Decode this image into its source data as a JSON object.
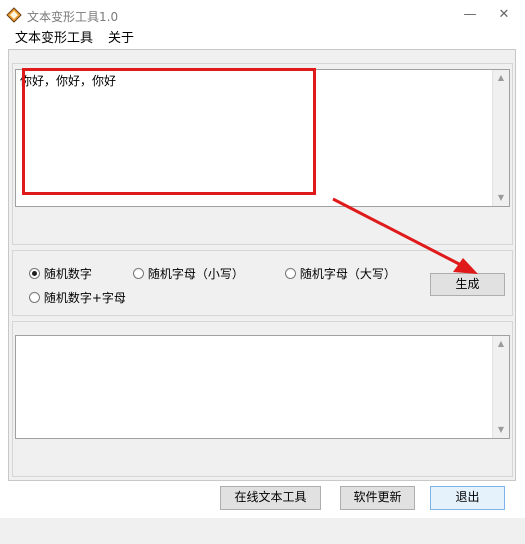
{
  "window": {
    "title": "文本变形工具1.0",
    "minimize_glyph": "—",
    "close_glyph": "✕"
  },
  "menu": {
    "items": [
      "文本变形工具",
      "关于"
    ]
  },
  "input": {
    "value": "你好，你好，你好"
  },
  "options": {
    "radios": [
      {
        "label": "随机数字",
        "checked": true
      },
      {
        "label": "随机字母（小写）",
        "checked": false
      },
      {
        "label": "随机字母（大写）",
        "checked": false
      },
      {
        "label": "随机数字+字母",
        "checked": false
      }
    ],
    "generate_label": "生成"
  },
  "output": {
    "value": ""
  },
  "footer": {
    "online_tools_label": "在线文本工具",
    "update_label": "软件更新",
    "exit_label": "退出"
  },
  "colors": {
    "annotation": "#e01a1a",
    "primary_button_border": "#7eb4ea"
  },
  "icons": {
    "app": "app-icon",
    "scroll_up": "scroll-up-arrow-icon",
    "scroll_down": "scroll-down-arrow-icon"
  }
}
